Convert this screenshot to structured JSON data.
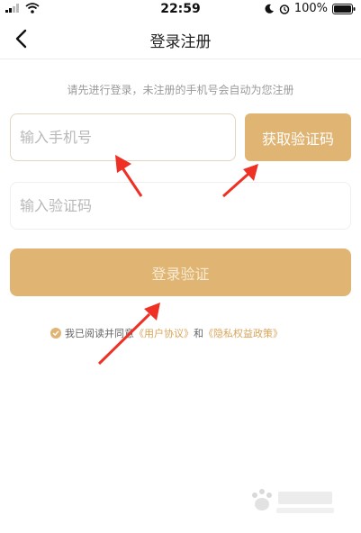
{
  "status_bar": {
    "time": "22:59",
    "battery": "100%",
    "icons": [
      "signal-icon",
      "wifi-icon",
      "moon-icon",
      "alarm-icon",
      "battery-icon"
    ]
  },
  "navbar": {
    "title": "登录注册",
    "back_icon": "chevron-left-icon"
  },
  "hint": "请先进行登录，未注册的手机号会自动为您注册",
  "form": {
    "phone_placeholder": "输入手机号",
    "get_code_label": "获取验证码",
    "code_placeholder": "输入验证码",
    "login_label": "登录验证"
  },
  "agreement": {
    "prefix": "我已阅读并同意",
    "user_agreement": "《用户协议》",
    "and": "和",
    "privacy_policy": "《隐私权益政策》"
  },
  "colors": {
    "accent": "#e0b573",
    "link": "#d9a55a",
    "annotation_arrow": "#ee3124"
  }
}
